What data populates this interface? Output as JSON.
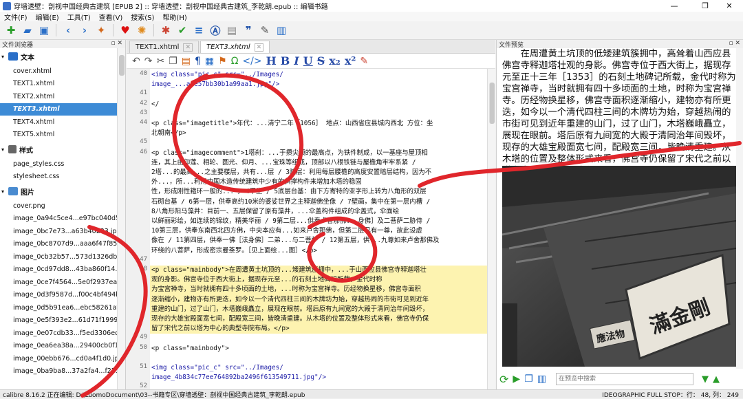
{
  "window": {
    "title": "穿墙透壁：剖视中国经典古建筑 [EPUB 2] :: 穿墙透壁：剖视中国经典古建筑_李乾朗.epub :: 编辑书籍"
  },
  "menu": [
    "文件(F)",
    "编辑(E)",
    "工具(T)",
    "查看(V)",
    "搜索(S)",
    "帮助(H)"
  ],
  "file_browser": {
    "title": "文件浏览器",
    "text_folder": "文本",
    "text_files": [
      "cover.xhtml",
      "TEXT1.xhtml",
      "TEXT2.xhtml",
      "TEXT3.xhtml",
      "TEXT4.xhtml",
      "TEXT5.xhtml"
    ],
    "selected": "TEXT3.xhtml",
    "style_folder": "样式",
    "style_files": [
      "page_styles.css",
      "stylesheet.css"
    ],
    "image_folder": "图片",
    "image_files": [
      "cover.png",
      "image_0a94c5ce4...e97bc040d5f.jpg",
      "image_0bc7e73...a63b40223.jpg",
      "image_0bc8707d9...aaa6f47f856.jpg",
      "image_0cb32b57...573d1326db.jpg",
      "image_0cd97dd8...43ba860f14.jpg",
      "image_0ce7f4564...5e0f2937eae.jpg",
      "image_0d3f9587d...f00c4bf494b.jpg",
      "image_0d5b91ea6...ebc58261af1.jpg",
      "image_0e5f393e2...61d71f19998.jpg",
      "image_0e07cdb33...f5ed3306edf.jpg",
      "image_0ea6ea38a...29400cb0f1.jpg",
      "image_00ebb676...cd0a4f1d0.jpg",
      "image_0ba9ba8...37a2fa4...f2754.jpg"
    ]
  },
  "editor": {
    "tabs": [
      "TEXT1.xhtml",
      "TEXT3.xhtml"
    ],
    "active_tab": "TEXT3.xhtml",
    "lines": [
      {
        "n": "40",
        "t": "    <img class=\"pic_c\" src=\"../Images/"
      },
      {
        "n": "",
        "t": "image_...a9e57bb30b1a99aa1.jpg\"/>"
      },
      {
        "n": "41",
        "t": ""
      },
      {
        "n": "42",
        "t": "    </"
      },
      {
        "n": "43",
        "t": ""
      },
      {
        "n": "44",
        "t": "    <p class=\"imagetitle\">年代：...清宁二年［1056］  地点：山西省应县城内西北  方位：坐"
      },
      {
        "n": "",
        "t": "北朝南</p>"
      },
      {
        "n": "45",
        "t": ""
      },
      {
        "n": "46",
        "t": "  <p class=\"imagecomment\">1塔刹：...于攒尖顶的最高点，为铁件制成，以一基座与屋顶相"
      },
      {
        "n": "",
        "t": "连，其上由仰莲、相轮、圆光、仰月、...宝珠等组成，顶部以八根铁链与屋檐角牢牢系紧 / "
      },
      {
        "n": "",
        "t": "2塔...的最高...之主要楼层，共有...层 / 3暗层：利用每层腰檐的高度安置暗层结构，因为不"
      },
      {
        "n": "",
        "t": "外...，所...利用中国木造传统建筑中少有的斜撑构件来增加木塔的稳固"
      },
      {
        "n": "",
        "t": "性，形成刚性箍环一般的... / 4平坐 / 5底层台基：由下方寄特的亚字形上转为八角形的双层"
      },
      {
        "n": "",
        "t": "石砌台基 / 6第一层，供奉高约10米的婆娑世界之主释迦佛坐像 / 7壁画，集中在第一层内槽 /"
      },
      {
        "n": "",
        "t": "8八角形阳马藻井：目前一、五层保留了原有藻井，...伞盖构件组成的伞盖式，伞面绘"
      },
      {
        "n": "",
        "t": "以鲜丽彩绘，如连续的锦纹，精美华丽 / 9第二层...供奉卢舍那佛...身佛］及二菩萨二胁侍 /"
      },
      {
        "n": "",
        "t": "10第三层，供奉东南西北四方佛，中央本应有...如来卢舍那佛，但第二层已有一尊，故此设虚"
      },
      {
        "n": "",
        "t": "像在 / 11第四层，供奉一佛［法身佛］二弟...与二菩萨 / 12第五层，供...九尊如来卢舍那佛及"
      },
      {
        "n": "",
        "t": "环绕的八菩萨，形成密宗曼荼罗。［见上面绘...图］</p>"
      },
      {
        "n": "47",
        "t": ""
      },
      {
        "n": "48",
        "t": "  <p class=\"mainbody\">在周遭黄土坑顶的...矮建筑簇拥中，...于山西应县佛宫寺释迦塔壮"
      },
      {
        "n": "",
        "t": "观的身影。佛宫寺位于西大街上，据现存元至...的石刻土地碑记所载，金代时称"
      },
      {
        "n": "",
        "t": "为宝宫禅寺，当时就拥有四十多顷面的土地，...时称为宝宫禅寺。历经物换星移，佛宫寺面积"
      },
      {
        "n": "",
        "t": "逐渐缩小，建物亦有所更迭，如今以一个清代四柱三间的木牌坊为始，穿越热闹的市街可见到近年"
      },
      {
        "n": "",
        "t": "重建的山门，过了山门，木塔巍峨矗立，展现在眼前。塔后原有九间宽的大殿于清同治年间毁坏，"
      },
      {
        "n": "",
        "t": "现存的大雄宝殿面宽七间，配殿宽三间，皆晚清重建。从木塔的位置及整体形式来看，佛宫寺仍保"
      },
      {
        "n": "",
        "t": "留了宋代之前以塔为中心的典型寺院布局。</p>"
      },
      {
        "n": "49",
        "t": ""
      },
      {
        "n": "50",
        "t": "  <p class=\"mainbody\">"
      },
      {
        "n": "",
        "t": ""
      },
      {
        "n": "51",
        "t": "    <img class=\"pic_c\" src=\"../Images/"
      },
      {
        "n": "",
        "t": "image_4b834c77ee764892ba2496f613549711.jpg\"/>"
      },
      {
        "n": "52",
        "t": ""
      },
      {
        "n": "",
        "t": "    </p>"
      }
    ]
  },
  "preview": {
    "title": "文件预览",
    "text": "在周遭黄土坑顶的低矮建筑簇拥中，高耸着山西应县佛宫寺释迦塔壮观的身影。佛宫寺位于西大街上，据现存元至正十三年［1353］的石刻土地碑记所载，金代时称为宝宫禅寺，当时就拥有四十多顷面的土地，时称为宝宫禅寺。历经物换星移，佛宫寺面积逐渐缩小，建物亦有所更迭，如今以一个清代四柱三间的木牌坊为始，穿越热闹的市街可见到近年重建的山门，过了山门，木塔巍峨矗立，展现在眼前。塔后原有九间宽的大殿于清同治年间毁坏，现存的大雄宝殿面宽七间，配殿宽三间，皆晚清重建。从木塔的位置及整体形式来看，佛宫寺仍保留了宋代之前以塔为中心的典型寺院布局。",
    "search_placeholder": "在预览中搜索",
    "plaque_text": "滿金剛",
    "plaque_small": "應法物"
  },
  "status": {
    "left": "calibre 8.16.2 正在编辑: D:\\LuomoDocument\\03--书籍专区\\穿墙透壁：剖视中国经典古建筑_李乾朗.epub",
    "right": "IDEOGRAPHIC FULL STOP：行： 48,  列： 249"
  },
  "colors": {
    "selection": "#3d8bd6",
    "highlight": "#fdf3b0",
    "annotation": "#e0262b"
  }
}
